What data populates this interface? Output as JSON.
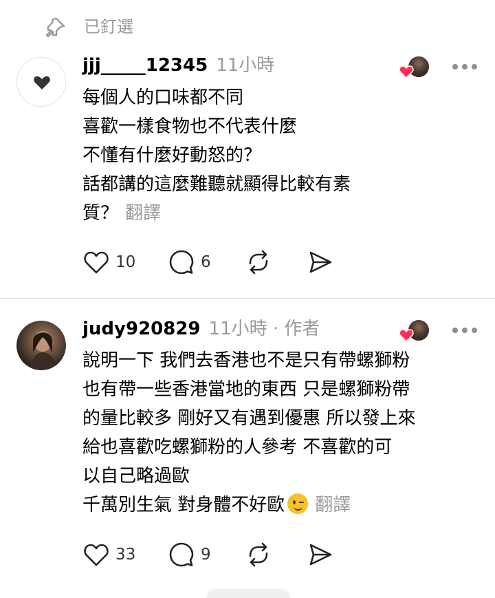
{
  "pinned": {
    "label": "已釘選"
  },
  "comments": [
    {
      "username": "jjj_____12345",
      "meta": "11小時",
      "lines": [
        "每個人的口味都不同",
        "喜歡一樣食物也不代表什麼",
        "不懂有什麼好動怒的？",
        "話都講的這麼難聽就顯得比較有素",
        "質？"
      ],
      "translate": "翻譯",
      "likes": "10",
      "replies": "6"
    },
    {
      "username": "judy920829",
      "meta": "11小時 · 作者",
      "lines": [
        "說明一下 我們去香港也不是只有帶螺獅粉",
        "也有帶一些香港當地的東西 只是螺獅粉帶",
        "的量比較多 剛好又有遇到優惠 所以發上來",
        "給也喜歡吃螺獅粉的人參考￼ 不喜歡的可",
        "以自己略過歐",
        "千萬別生氣 對身體不好歐"
      ],
      "translate": "翻譯",
      "likes": "33",
      "replies": "9"
    }
  ],
  "icons": {
    "pin": "pin-icon",
    "heart": "heart-icon",
    "reply": "comment-icon",
    "repost": "repost-icon",
    "share": "share-icon",
    "more": "more-icon",
    "wink": "wink-emoji-icon"
  },
  "colors": {
    "liked_heart": "#ff2d55",
    "muted_text": "#9a9a9a"
  }
}
